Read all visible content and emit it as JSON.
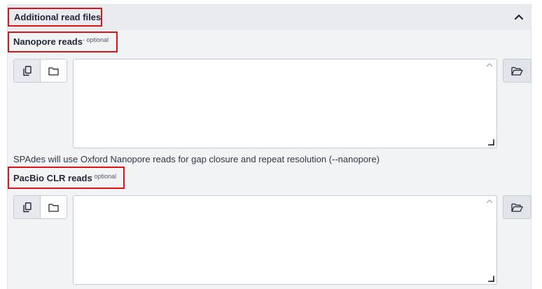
{
  "section": {
    "title": "Additional read files",
    "collapse_icon": "chevron-up-icon"
  },
  "fields": [
    {
      "label": "Nanopore reads",
      "optional_tag": "- optional",
      "value": "",
      "help": "SPAdes will use Oxford Nanopore reads for gap closure and repeat resolution (--nanopore)",
      "icons": [
        "copy-icon",
        "folder-icon",
        "folder-open-icon"
      ]
    },
    {
      "label": "PacBio CLR reads",
      "optional_tag": "- optional",
      "value": "",
      "icons": [
        "copy-icon",
        "folder-icon",
        "folder-open-icon"
      ]
    }
  ],
  "colors": {
    "highlight": "#d9141a",
    "panel_bg": "#f2f3f5",
    "header_bg": "#e9ebef"
  }
}
